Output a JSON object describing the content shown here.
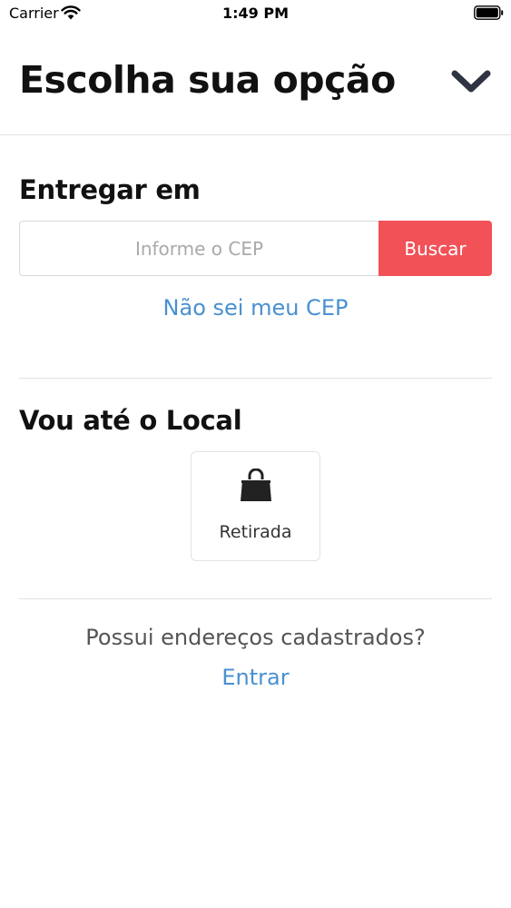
{
  "status_bar": {
    "carrier": "Carrier",
    "time": "1:49 PM",
    "icons": [
      "wifi-icon",
      "battery-icon"
    ]
  },
  "header": {
    "title": "Escolha sua opção",
    "collapse_icon": "chevron-down-icon"
  },
  "delivery": {
    "title": "Entregar em",
    "cep_input": {
      "value": "",
      "placeholder": "Informe o CEP"
    },
    "search_label": "Buscar",
    "unknown_cep_link": "Não sei meu CEP"
  },
  "pickup": {
    "title": "Vou até o Local",
    "option_label": "Retirada",
    "option_icon": "shopping-bag-icon"
  },
  "account": {
    "question": "Possui endereços cadastrados?",
    "login_link": "Entrar"
  },
  "colors": {
    "accent": "#f15157",
    "link": "#4a90d0",
    "text": "#111111",
    "divider": "#e0e0e0"
  }
}
